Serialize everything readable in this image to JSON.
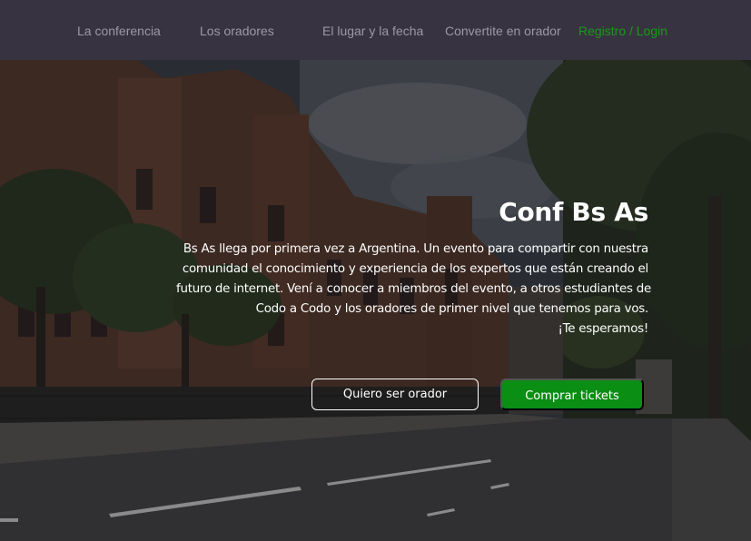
{
  "nav": {
    "items": [
      {
        "label": "La conferencia",
        "color": "#9c98a6"
      },
      {
        "label": "Los oradores",
        "color": "#9c98a6"
      },
      {
        "label": "El lugar y la fecha",
        "color": "#9c98a6"
      },
      {
        "label": "Convertite en orador",
        "color": "#9c98a6"
      },
      {
        "label": "Registro / Login",
        "color": "#199b19"
      }
    ],
    "background": "#383341"
  },
  "hero": {
    "title": "Conf Bs As",
    "description_lines": [
      "Bs As llega por primera vez a Argentina. Un evento para compartir con nuestra",
      "comunidad el conocimiento y experiencia de los expertos que están creando el",
      "futuro de internet. Vení a conocer a miembros del evento, a otros estudiantes de",
      "Codo a Codo y los oradores de primer nivel que tenemos para vos.",
      "¡Te esperamos!"
    ],
    "buttons": {
      "speaker": "Quiero ser orador",
      "tickets": "Comprar tickets"
    },
    "accent": "#0a8e14"
  }
}
